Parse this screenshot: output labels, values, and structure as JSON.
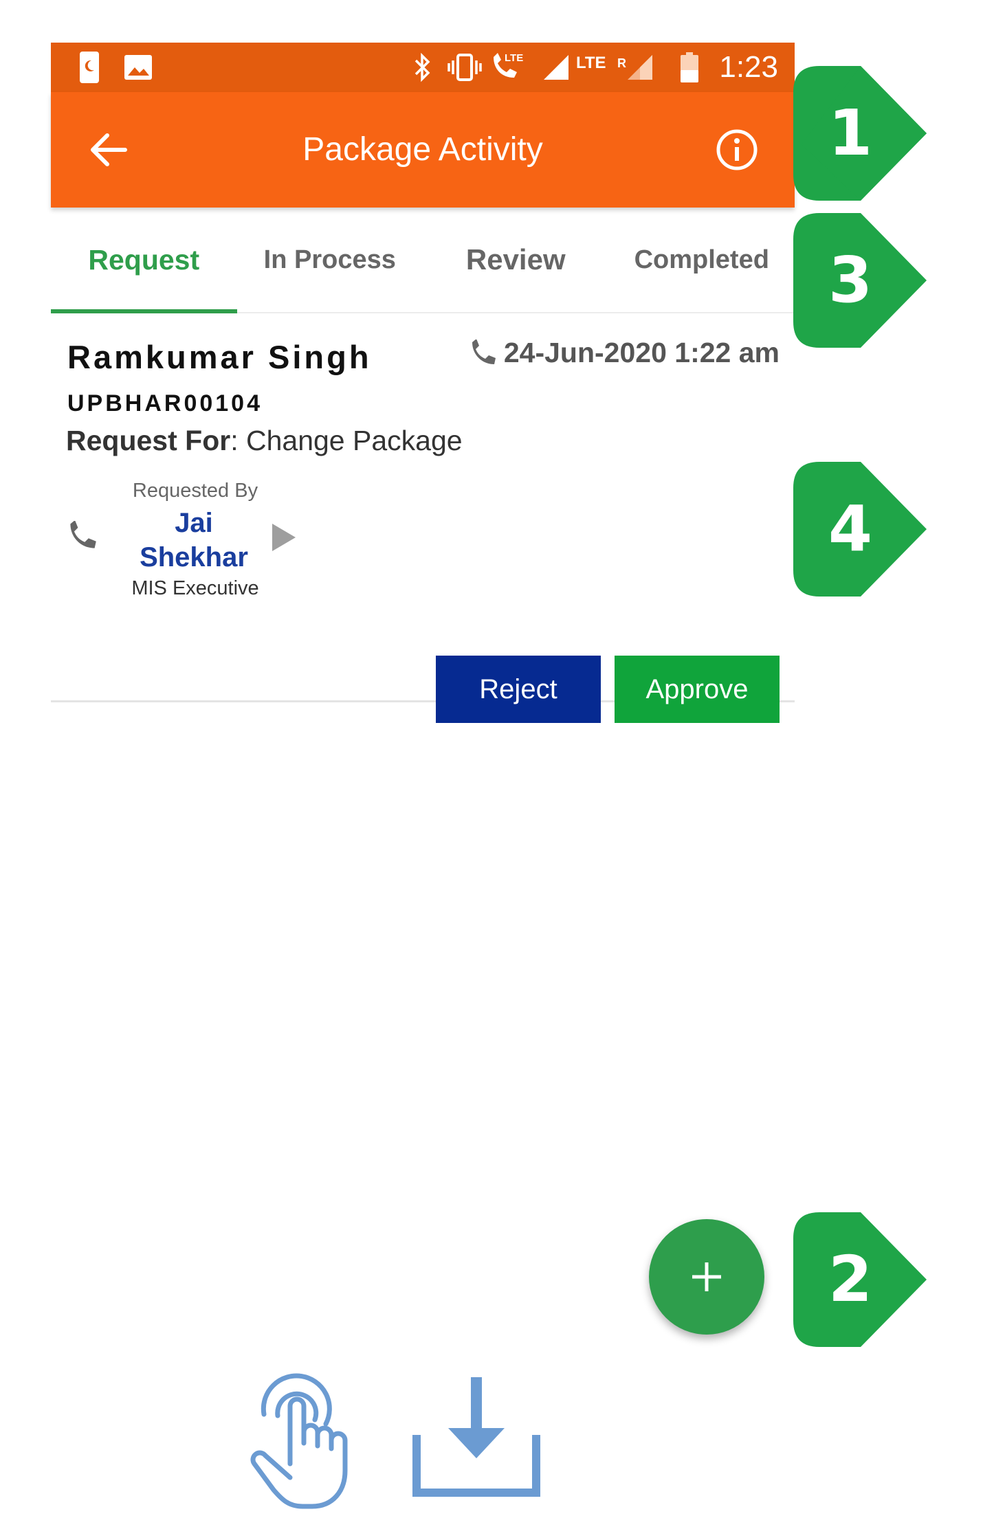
{
  "status_bar": {
    "time": "1:23",
    "lte_label": "LTE",
    "lte2_label": "LTE",
    "roaming_label": "R",
    "icons": [
      "notification-icon",
      "image-icon",
      "bluetooth-icon",
      "vibrate-icon",
      "volte-call-icon",
      "signal-icon",
      "roaming-signal-icon",
      "battery-icon"
    ]
  },
  "app_bar": {
    "title": "Package Activity",
    "back_icon": "arrow-left-icon",
    "info_icon": "info-icon"
  },
  "tabs": [
    {
      "label": "Request",
      "active": true
    },
    {
      "label": "In Process",
      "active": false
    },
    {
      "label": "Review",
      "active": false
    },
    {
      "label": "Completed",
      "active": false
    }
  ],
  "request_card": {
    "customer_name": "Ramkumar Singh",
    "customer_id": "UPBHAR00104",
    "request_for_label": "Request For",
    "request_for_value": ": Change Package",
    "datetime": "24-Jun-2020 1:22 am",
    "requested_by_label": "Requested By",
    "requested_by_name": "Jai Shekhar",
    "requested_by_role": "MIS Executive",
    "reject_label": "Reject",
    "approve_label": "Approve"
  },
  "fab": {
    "symbol": "+"
  },
  "callouts": [
    "1",
    "3",
    "4",
    "2"
  ],
  "colors": {
    "status_bar": "#e35c0e",
    "app_bar": "#f76414",
    "active_tab": "#2f9e4b",
    "reject": "#062a91",
    "approve": "#10a43b",
    "callout": "#1fa548",
    "fab": "#2e9e4c"
  }
}
